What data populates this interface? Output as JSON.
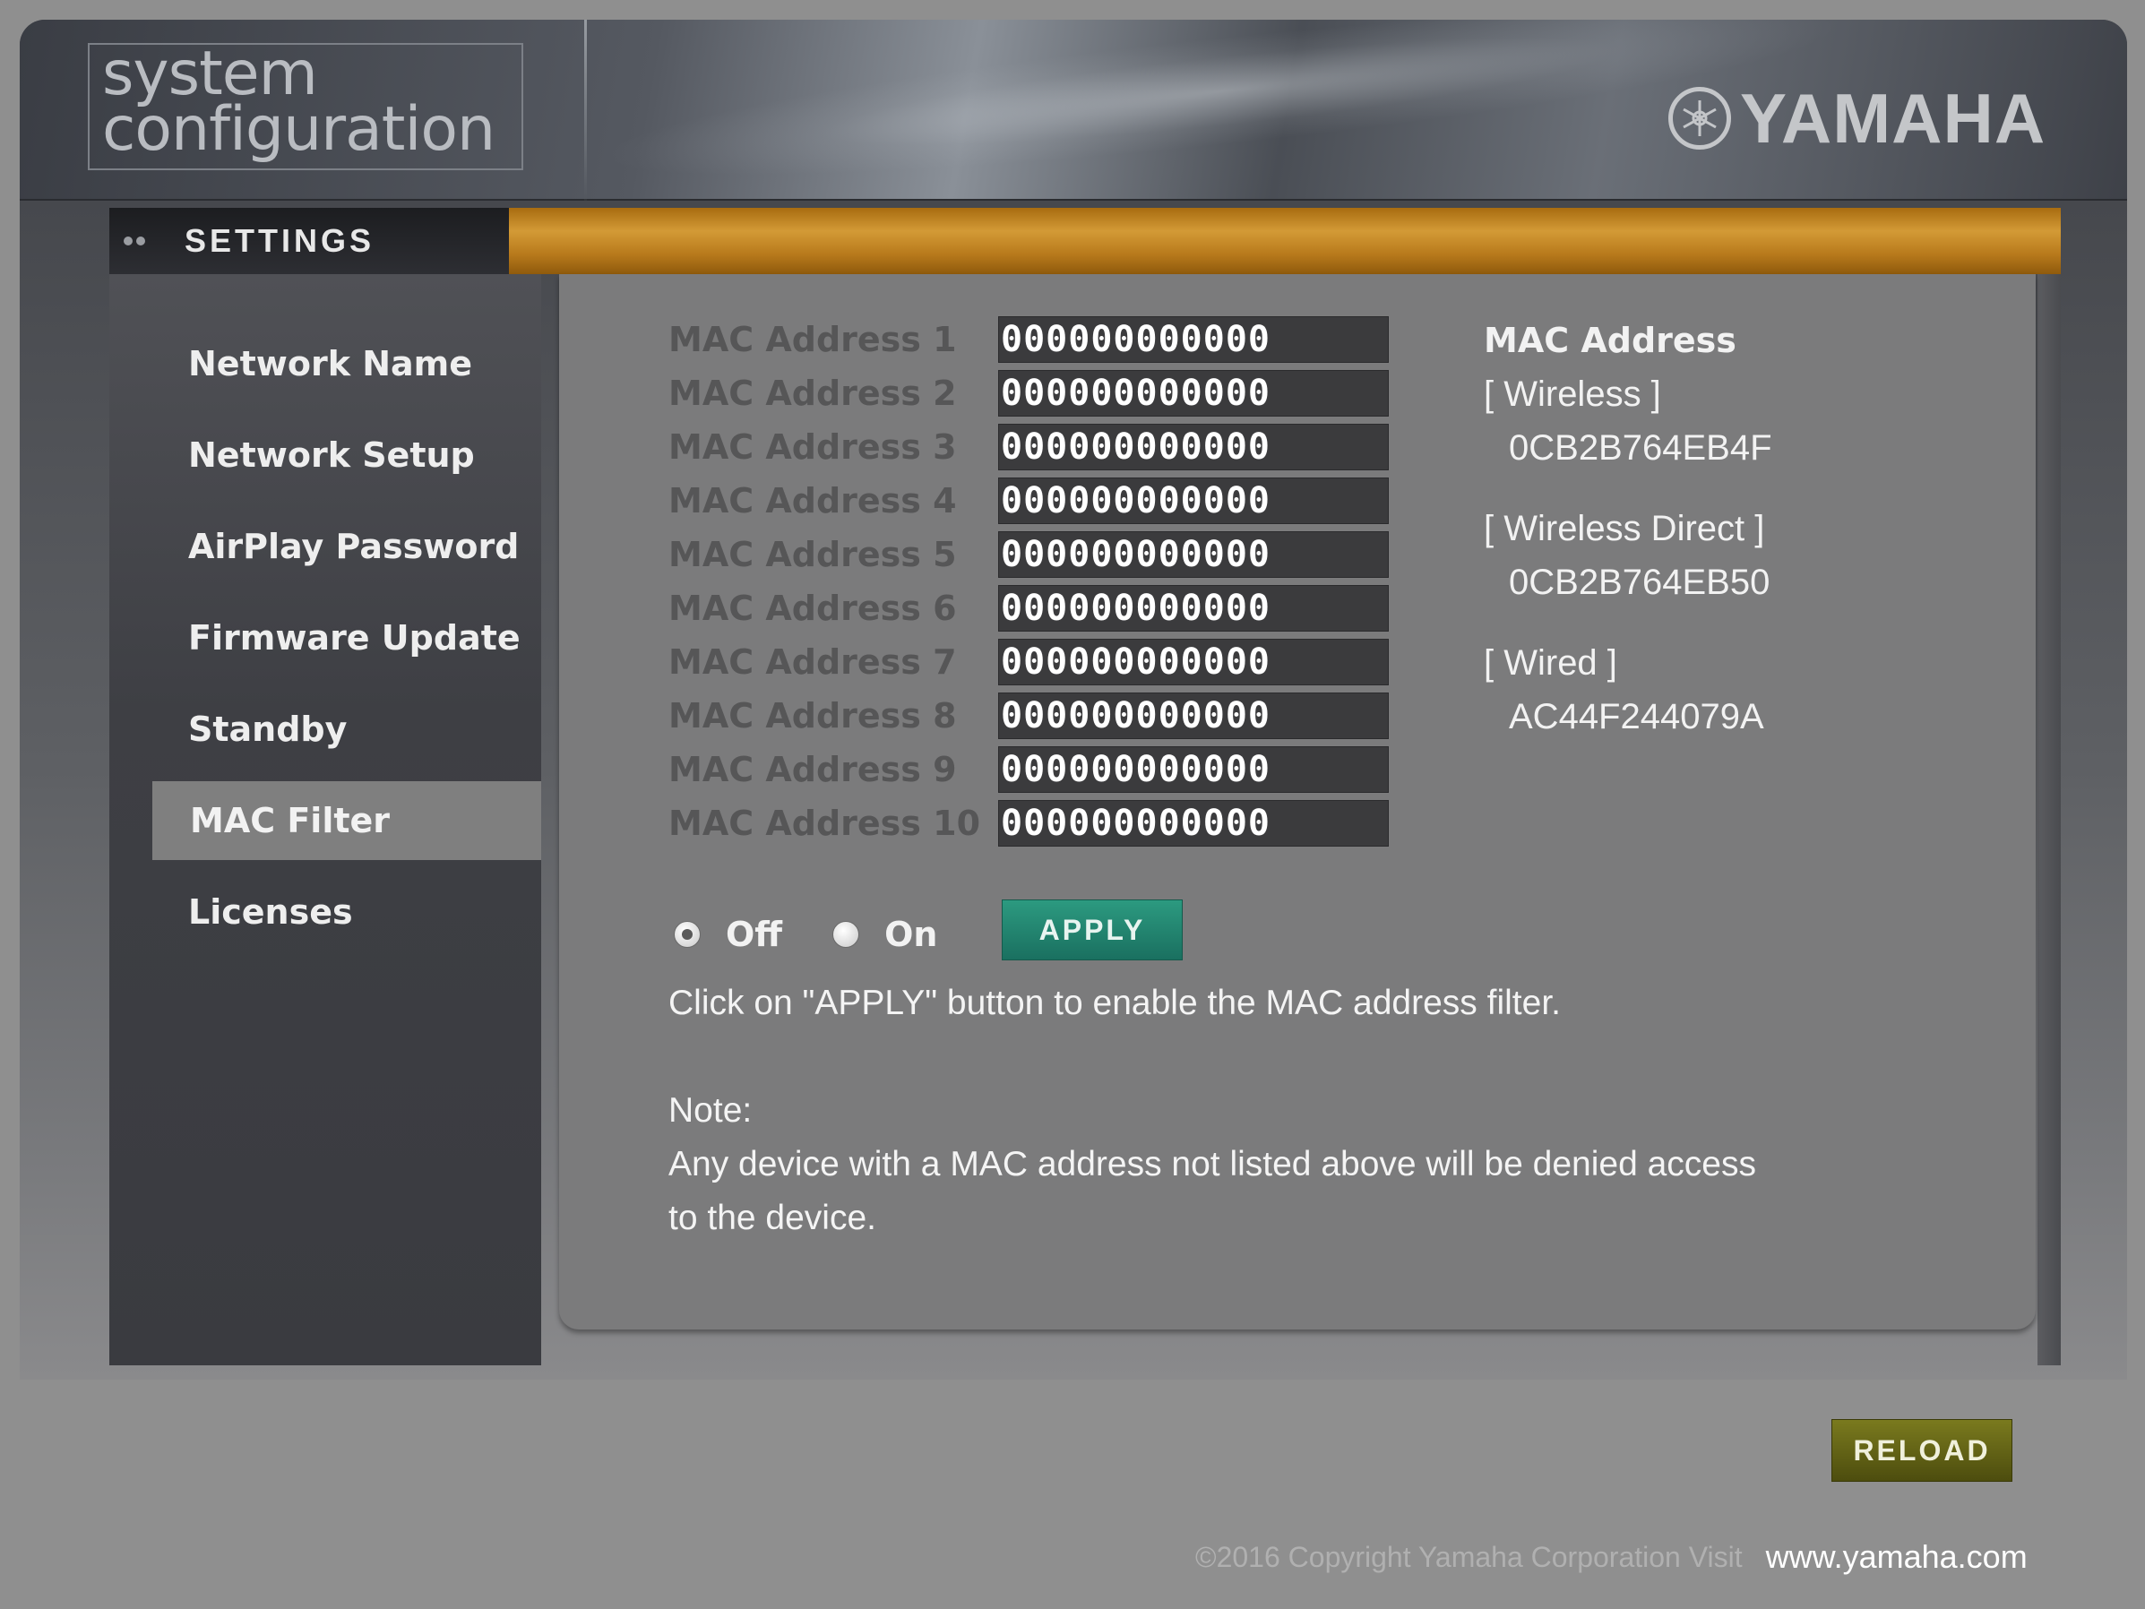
{
  "header": {
    "logo_line1": "system",
    "logo_line2": "configuration",
    "brand": "YAMAHA",
    "brand_icon": "tuning-fork-emblem-icon"
  },
  "settings": {
    "label": "SETTINGS"
  },
  "sidebar": {
    "items": [
      {
        "label": "Network Name"
      },
      {
        "label": "Network Setup"
      },
      {
        "label": "AirPlay Password"
      },
      {
        "label": "Firmware Update"
      },
      {
        "label": "Standby"
      },
      {
        "label": "MAC Filter",
        "active": true
      },
      {
        "label": "Licenses"
      }
    ]
  },
  "mac_filter": {
    "entries": [
      {
        "label": "MAC Address 1",
        "value": "000000000000"
      },
      {
        "label": "MAC Address 2",
        "value": "000000000000"
      },
      {
        "label": "MAC Address 3",
        "value": "000000000000"
      },
      {
        "label": "MAC Address 4",
        "value": "000000000000"
      },
      {
        "label": "MAC Address 5",
        "value": "000000000000"
      },
      {
        "label": "MAC Address 6",
        "value": "000000000000"
      },
      {
        "label": "MAC Address 7",
        "value": "000000000000"
      },
      {
        "label": "MAC Address 8",
        "value": "000000000000"
      },
      {
        "label": "MAC Address 9",
        "value": "000000000000"
      },
      {
        "label": "MAC Address 10",
        "value": "000000000000"
      }
    ],
    "radio_off": "Off",
    "radio_on": "On",
    "selected": "Off",
    "apply_label": "APPLY",
    "instruction": "Click on \"APPLY\" button to enable the MAC address filter.",
    "note_title": "Note:",
    "note_line1": "Any device with a MAC address not listed above will be denied access",
    "note_line2": "to the device."
  },
  "device_info": {
    "title": "MAC Address",
    "wireless_label": "[ Wireless ]",
    "wireless_value": "0CB2B764EB4F",
    "wireless_direct_label": "[ Wireless Direct ]",
    "wireless_direct_value": "0CB2B764EB50",
    "wired_label": "[ Wired ]",
    "wired_value": "AC44F244079A"
  },
  "footer": {
    "reload_label": "RELOAD",
    "copyright": "©2016 Copyright Yamaha Corporation Visit",
    "link": "www.yamaha.com"
  },
  "colors": {
    "accent_orange": "#d39a36",
    "apply_green": "#2c9a80",
    "reload_olive": "#7a7a1e"
  }
}
